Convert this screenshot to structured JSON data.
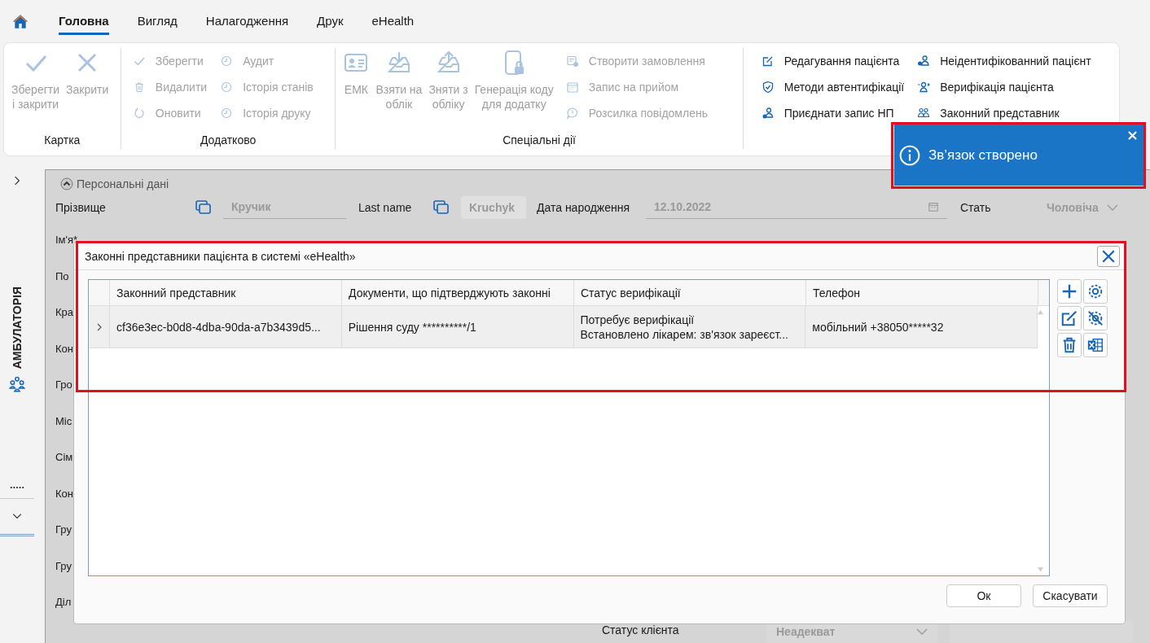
{
  "top_tabs": [
    {
      "label": "Головна",
      "selected": true
    },
    {
      "label": "Вигляд",
      "selected": false
    },
    {
      "label": "Налагодження",
      "selected": false
    },
    {
      "label": "Друк",
      "selected": false
    },
    {
      "label": "eHealth",
      "selected": false
    }
  ],
  "ribbon": [
    {
      "title": "Картка",
      "items": [
        {
          "kind": "large",
          "label": "Зберегти\nі закрити",
          "disabled": true
        },
        {
          "kind": "large",
          "label": "Закрити",
          "disabled": true
        }
      ]
    },
    {
      "title": "Додатково",
      "items": [
        {
          "kind": "small",
          "label": "Зберегти",
          "disabled": true
        },
        {
          "kind": "small",
          "label": "Видалити",
          "disabled": true
        },
        {
          "kind": "small",
          "label": "Оновити",
          "disabled": true
        },
        {
          "kind": "small",
          "label": "Аудит",
          "disabled": true
        },
        {
          "kind": "small",
          "label": "Історія станів",
          "disabled": true
        },
        {
          "kind": "small",
          "label": "Історія друку",
          "disabled": true
        }
      ]
    },
    {
      "title": "Спеціальні дії",
      "items": [
        {
          "kind": "large",
          "label": "ЕМК",
          "disabled": true
        },
        {
          "kind": "large",
          "label": "Взяти на\nоблік",
          "disabled": true
        },
        {
          "kind": "large",
          "label": "Зняти з\nобліку",
          "disabled": true
        },
        {
          "kind": "large",
          "label": "Генерація коду\nдля додатку",
          "disabled": true
        },
        {
          "kind": "small",
          "label": "Створити замовлення",
          "disabled": true
        },
        {
          "kind": "small",
          "label": "Запис на прийом",
          "disabled": true
        },
        {
          "kind": "small",
          "label": "Розсилка повідомлень",
          "disabled": true
        }
      ]
    },
    {
      "items": [
        {
          "kind": "small",
          "label": "Редагування пацієнта",
          "disabled": false
        },
        {
          "kind": "small",
          "label": "Методи автентифікації",
          "disabled": false
        },
        {
          "kind": "small",
          "label": "Приєднати запис НП",
          "disabled": false
        },
        {
          "kind": "small",
          "label": "Неідентифікованний пацієнт",
          "disabled": false
        },
        {
          "kind": "small",
          "label": "Верифікація пацієнта",
          "disabled": false
        },
        {
          "kind": "small",
          "label": "Законний представник",
          "disabled": false
        }
      ]
    }
  ],
  "sidebar": {
    "title": "АМБУЛАТОРІЯ"
  },
  "form": {
    "section": "Персональні дані",
    "expanded": true,
    "fields": [
      {
        "kind": "line",
        "label": "Прізвище",
        "value": "Кручик",
        "copy": true
      },
      {
        "kind": "box",
        "label": "Last name",
        "value": "Kruchyk",
        "copy": true
      },
      {
        "kind": "date",
        "label": "Дата народження",
        "value": "12.10.2022",
        "copy": false
      },
      {
        "kind": "select",
        "label": "Стать",
        "value": "Чоловіча",
        "copy": false
      }
    ],
    "row_labels": [
      "Ім'я*",
      "По",
      "Кра",
      "Кон",
      "Гро",
      "Міс",
      "Сім",
      "Кон",
      "Гру",
      "Гру",
      "Діл"
    ],
    "status": {
      "label": "Статус клієнта",
      "value": "Неадекват"
    }
  },
  "dialog": {
    "title": "Законні представники пацієнта в системі «eHealth»",
    "columns": [
      "Законний представник",
      "Документи, що підтверджують законні",
      "Статус верифікації",
      "Телефон"
    ],
    "rows": [
      {
        "selected": true,
        "expanded": false,
        "cells": [
          "cf36e3ec-b0d8-4dba-90da-a7b3439d5...",
          "Рішення суду **********/1",
          "Потребує верифікації\nВстановлено лікарем: зв'язок зареєст...",
          "мобільний +38050*****32"
        ]
      }
    ],
    "buttons": [
      "Ок",
      "Скасувати"
    ]
  },
  "toast": {
    "message": "Зв’язок створено"
  }
}
